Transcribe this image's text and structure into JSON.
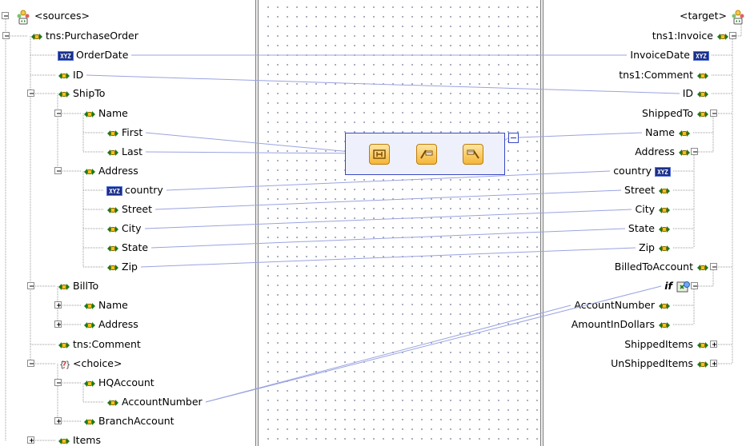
{
  "source_tree": {
    "root": "<sources>",
    "nodes": [
      {
        "label": "tns:PurchaseOrder",
        "icon": "element-icon"
      },
      {
        "label": "OrderDate",
        "icon": "xyz-attribute-icon"
      },
      {
        "label": "ID",
        "icon": "element-icon"
      },
      {
        "label": "ShipTo",
        "icon": "element-icon"
      },
      {
        "label": "Name",
        "icon": "element-icon"
      },
      {
        "label": "First",
        "icon": "element-icon"
      },
      {
        "label": "Last",
        "icon": "element-icon"
      },
      {
        "label": "Address",
        "icon": "element-icon"
      },
      {
        "label": "country",
        "icon": "xyz-attribute-icon"
      },
      {
        "label": "Street",
        "icon": "element-icon"
      },
      {
        "label": "City",
        "icon": "element-icon"
      },
      {
        "label": "State",
        "icon": "element-icon"
      },
      {
        "label": "Zip",
        "icon": "element-icon"
      },
      {
        "label": "BillTo",
        "icon": "element-icon"
      },
      {
        "label": "Name",
        "icon": "element-icon"
      },
      {
        "label": "Address",
        "icon": "element-icon"
      },
      {
        "label": "tns:Comment",
        "icon": "element-icon"
      },
      {
        "label": "<choice>",
        "icon": "choice-icon"
      },
      {
        "label": "HQAccount",
        "icon": "element-icon"
      },
      {
        "label": "AccountNumber",
        "icon": "element-icon"
      },
      {
        "label": "BranchAccount",
        "icon": "element-icon"
      },
      {
        "label": "Items",
        "icon": "element-icon"
      }
    ]
  },
  "target_tree": {
    "root": "<target>",
    "nodes": [
      {
        "label": "tns1:Invoice",
        "icon": "element-icon"
      },
      {
        "label": "InvoiceDate",
        "icon": "xyz-attribute-icon"
      },
      {
        "label": "tns1:Comment",
        "icon": "element-icon"
      },
      {
        "label": "ID",
        "icon": "element-icon"
      },
      {
        "label": "ShippedTo",
        "icon": "element-icon"
      },
      {
        "label": "Name",
        "icon": "element-icon"
      },
      {
        "label": "Address",
        "icon": "element-icon"
      },
      {
        "label": "country",
        "icon": "xyz-attribute-icon"
      },
      {
        "label": "Street",
        "icon": "element-icon"
      },
      {
        "label": "City",
        "icon": "element-icon"
      },
      {
        "label": "State",
        "icon": "element-icon"
      },
      {
        "label": "Zip",
        "icon": "element-icon"
      },
      {
        "label": "BilledToAccount",
        "icon": "element-icon"
      },
      {
        "label": "if",
        "icon": "if-condition-icon"
      },
      {
        "label": "AccountNumber",
        "icon": "element-icon"
      },
      {
        "label": "AmountInDollars",
        "icon": "element-icon"
      },
      {
        "label": "ShippedItems",
        "icon": "element-icon"
      },
      {
        "label": "UnShippedItems",
        "icon": "element-icon"
      }
    ]
  },
  "function_chain": {
    "functions": [
      "concat-function-icon",
      "trim-function-icon",
      "upper-case-function-icon"
    ]
  },
  "colors": {
    "link": "#9aa3e0",
    "function_border": "#3848c4",
    "icon_orange": "#f5b636"
  }
}
